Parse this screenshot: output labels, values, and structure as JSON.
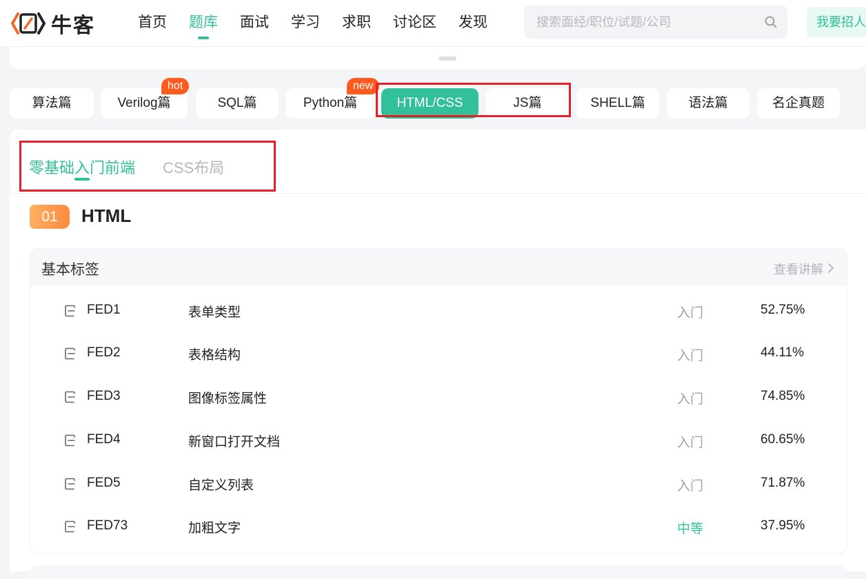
{
  "header": {
    "logo_text": "牛客",
    "nav": [
      "首页",
      "题库",
      "面试",
      "学习",
      "求职",
      "讨论区",
      "发现"
    ],
    "search_placeholder": "搜索面经/职位/试题/公司",
    "recruit_label": "我要招人"
  },
  "categories": [
    {
      "label": "算法篇"
    },
    {
      "label": "Verilog篇",
      "badge": "hot"
    },
    {
      "label": "SQL篇"
    },
    {
      "label": "Python篇",
      "badge": "new"
    },
    {
      "label": "HTML/CSS",
      "active": true
    },
    {
      "label": "JS篇"
    },
    {
      "label": "SHELL篇"
    },
    {
      "label": "语法篇"
    },
    {
      "label": "名企真题"
    }
  ],
  "subtabs": [
    "零基础入门前端",
    "CSS布局"
  ],
  "section": {
    "num": "01",
    "title": "HTML"
  },
  "card": {
    "title": "基本标签",
    "link": "查看讲解",
    "rows": [
      {
        "id": "FED1",
        "title": "表单类型",
        "level": "入门",
        "rate": "52.75%"
      },
      {
        "id": "FED2",
        "title": "表格结构",
        "level": "入门",
        "rate": "44.11%"
      },
      {
        "id": "FED3",
        "title": "图像标签属性",
        "level": "入门",
        "rate": "74.85%"
      },
      {
        "id": "FED4",
        "title": "新窗口打开文档",
        "level": "入门",
        "rate": "60.65%"
      },
      {
        "id": "FED5",
        "title": "自定义列表",
        "level": "入门",
        "rate": "71.87%"
      },
      {
        "id": "FED73",
        "title": "加粗文字",
        "level": "中等",
        "rate": "37.95%"
      }
    ]
  },
  "colors": {
    "accent": "#32c09a",
    "badge": "#ff5a1f",
    "highlight_box": "#e6202a",
    "section_num": "#ff9a4a"
  }
}
